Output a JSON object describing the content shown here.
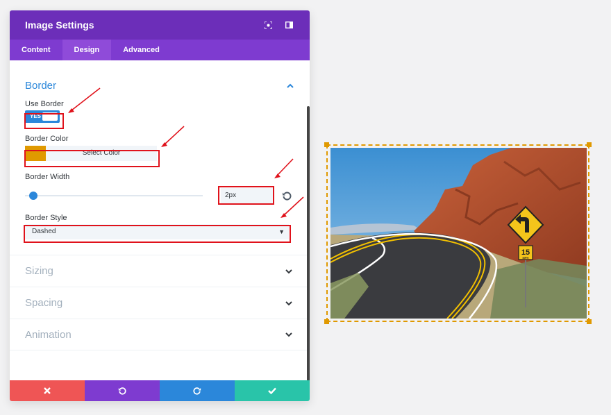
{
  "modal": {
    "title": "Image Settings",
    "tabs": [
      {
        "label": "Content"
      },
      {
        "label": "Design"
      },
      {
        "label": "Advanced"
      }
    ],
    "active_tab": "Design"
  },
  "border_section": {
    "title": "Border",
    "use_border": {
      "label": "Use Border",
      "value": "YES"
    },
    "border_color": {
      "label": "Border Color",
      "button": "Select Color",
      "swatch": "#e09900"
    },
    "border_width": {
      "label": "Border Width",
      "value": "2px"
    },
    "border_style": {
      "label": "Border Style",
      "value": "Dashed"
    }
  },
  "sections": [
    {
      "label": "Sizing"
    },
    {
      "label": "Spacing"
    },
    {
      "label": "Animation"
    }
  ],
  "colors": {
    "header": "#6c2eb9",
    "tabs": "#7e3bd0",
    "accent": "#2b87da",
    "cancel": "#ef5555",
    "undo": "#7e3bd0",
    "redo": "#2b87da",
    "save": "#29c4a9",
    "highlight": "#e0121b",
    "border_preview": "#e09900"
  },
  "icons": [
    "fullscreen-icon",
    "sidebar-icon",
    "chevron-up-icon",
    "chevron-down-icon",
    "reset-icon",
    "close-icon",
    "undo-icon",
    "redo-icon",
    "check-icon"
  ],
  "preview": {
    "image": "desert road with curve sign",
    "sign_text": "15",
    "sign_subtext": "MPH"
  }
}
